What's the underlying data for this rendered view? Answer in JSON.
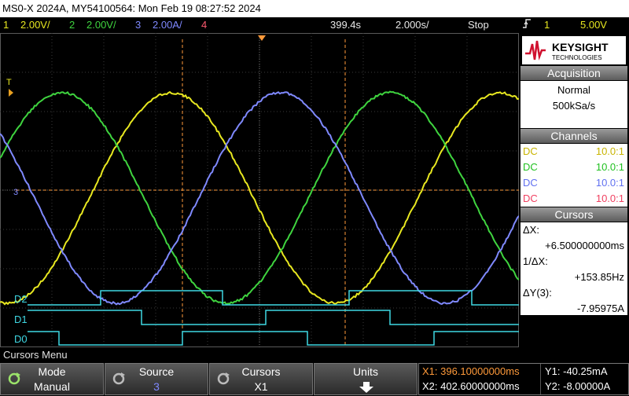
{
  "title": "MS0-X 2024A, MY54100564: Mon Feb 19 08:27:52 2024",
  "status": {
    "ch1_num": "1",
    "ch1_scale": "2.00V/",
    "ch2_num": "2",
    "ch2_scale": "2.00V/",
    "ch3_num": "3",
    "ch3_scale": "2.00A/",
    "ch4_num": "4",
    "time_offset": "399.4s",
    "timebase": "2.000s/",
    "run_state": "Stop",
    "trigger_channel": "1",
    "trigger_level": "5.00V"
  },
  "colors": {
    "ch1": "#e8e820",
    "ch2": "#3fd43f",
    "ch3": "#7f89ff",
    "ch4": "#ff5a70",
    "digital": "#3fd7e3",
    "cursor": "#ff9a3a"
  },
  "logo": {
    "brand": "KEYSIGHT",
    "sub": "TECHNOLOGIES"
  },
  "acquisition": {
    "header": "Acquisition",
    "mode": "Normal",
    "rate": "500kSa/s"
  },
  "channels": {
    "header": "Channels",
    "rows": [
      {
        "coupling": "DC",
        "probe": "10.0:1"
      },
      {
        "coupling": "DC",
        "probe": "10.0:1"
      },
      {
        "coupling": "DC",
        "probe": "10.0:1"
      },
      {
        "coupling": "DC",
        "probe": "10.0:1"
      }
    ]
  },
  "cursors": {
    "header": "Cursors",
    "dx_label": "ΔX:",
    "dx_value": "+6.500000000ms",
    "inv_dx_label": "1/ΔX:",
    "inv_dx_value": "+153.85Hz",
    "dy_label": "ΔY(3):",
    "dy_value": "-7.95975A"
  },
  "digital_labels": {
    "d2": "D2",
    "d1": "D1",
    "d0": "D0"
  },
  "markers": {
    "trigger": "T",
    "ch3_ground": "3"
  },
  "menu": {
    "label": "Cursors Menu",
    "mode_title": "Mode",
    "mode_value": "Manual",
    "source_title": "Source",
    "source_value": "3",
    "cursors_title": "Cursors",
    "cursors_value": "X1",
    "units_title": "Units"
  },
  "readout": {
    "x1": "X1: 396.10000000ms",
    "x2": "X2: 402.60000000ms",
    "y1": "Y1: -40.25mA",
    "y2": "Y2: -8.00000A"
  },
  "icons": {
    "mode": "rotate-knob-icon",
    "units": "down-arrow-icon",
    "trigger": "rising-edge-icon"
  }
}
